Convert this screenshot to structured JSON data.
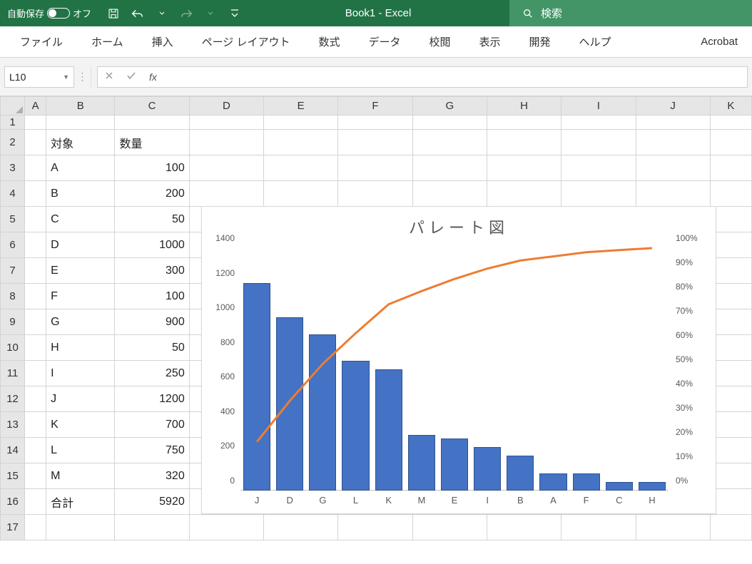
{
  "titlebar": {
    "autosave_label": "自動保存",
    "autosave_state": "オフ",
    "title": "Book1  -  Excel",
    "search_placeholder": "検索"
  },
  "ribbon": {
    "tabs": [
      "ファイル",
      "ホーム",
      "挿入",
      "ページ レイアウト",
      "数式",
      "データ",
      "校閲",
      "表示",
      "開発",
      "ヘルプ",
      "Acrobat"
    ]
  },
  "formula_bar": {
    "name_box": "L10",
    "fx_label": "fx",
    "formula": ""
  },
  "grid": {
    "columns": [
      "A",
      "B",
      "C",
      "D",
      "E",
      "F",
      "G",
      "H",
      "I",
      "J",
      "K"
    ],
    "headers": {
      "B2": "対象",
      "C2": "数量"
    },
    "rows": [
      {
        "r": 3,
        "b": "A",
        "c": 100
      },
      {
        "r": 4,
        "b": "B",
        "c": 200
      },
      {
        "r": 5,
        "b": "C",
        "c": 50
      },
      {
        "r": 6,
        "b": "D",
        "c": 1000
      },
      {
        "r": 7,
        "b": "E",
        "c": 300
      },
      {
        "r": 8,
        "b": "F",
        "c": 100
      },
      {
        "r": 9,
        "b": "G",
        "c": 900
      },
      {
        "r": 10,
        "b": "H",
        "c": 50
      },
      {
        "r": 11,
        "b": "I",
        "c": 250
      },
      {
        "r": 12,
        "b": "J",
        "c": 1200
      },
      {
        "r": 13,
        "b": "K",
        "c": 700
      },
      {
        "r": 14,
        "b": "L",
        "c": 750
      },
      {
        "r": 15,
        "b": "M",
        "c": 320
      }
    ],
    "total_row": {
      "r": 16,
      "b": "合計",
      "c": 5920
    },
    "visible_rows": 17,
    "selected_row": 10
  },
  "chart_data": {
    "type": "pareto",
    "title": "パレート図",
    "categories": [
      "J",
      "D",
      "G",
      "L",
      "K",
      "M",
      "E",
      "I",
      "B",
      "A",
      "F",
      "C",
      "H"
    ],
    "bar_values": [
      1200,
      1000,
      900,
      750,
      700,
      320,
      300,
      250,
      200,
      100,
      100,
      50,
      50
    ],
    "cumulative_pct": [
      20.3,
      37.2,
      52.4,
      65.0,
      76.9,
      82.3,
      87.3,
      91.6,
      94.9,
      96.6,
      98.3,
      99.2,
      100.0
    ],
    "y_left": {
      "min": 0,
      "max": 1400,
      "step": 200,
      "ticks": [
        0,
        200,
        400,
        600,
        800,
        1000,
        1200,
        1400
      ]
    },
    "y_right": {
      "min": 0,
      "max": 100,
      "step": 10,
      "ticks": [
        "0%",
        "10%",
        "20%",
        "30%",
        "40%",
        "50%",
        "60%",
        "70%",
        "80%",
        "90%",
        "100%"
      ]
    }
  }
}
